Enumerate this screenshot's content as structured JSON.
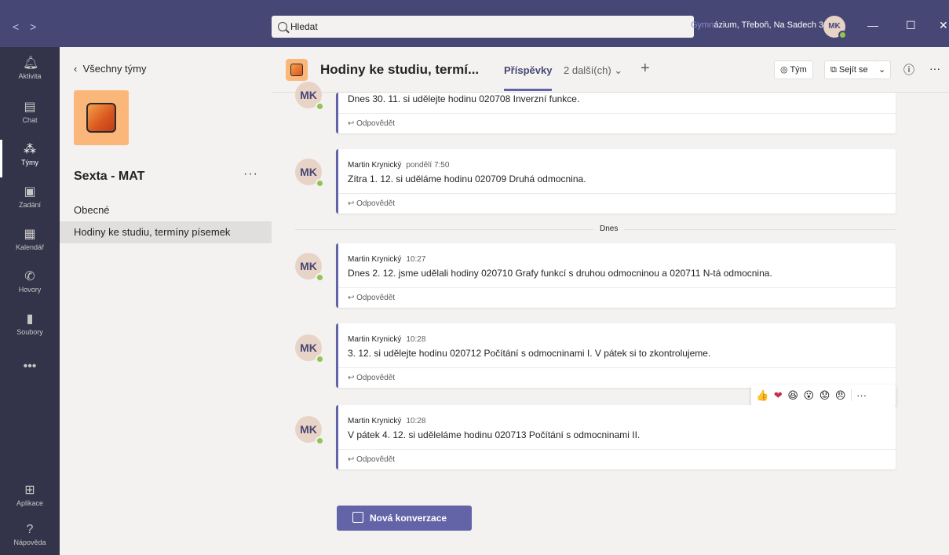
{
  "titlebar": {
    "back_icon": "chevron-left",
    "forward_icon": "chevron-right",
    "search_placeholder": "Hledat",
    "org_prefix": "Gymn",
    "org_rest": "ázium, Třeboň, Na Sadech 308",
    "avatar_initials": "MK"
  },
  "rail": {
    "items": [
      {
        "label": "Aktivita",
        "icon": "bell-icon"
      },
      {
        "label": "Chat",
        "icon": "chat-icon"
      },
      {
        "label": "Týmy",
        "icon": "teams-icon"
      },
      {
        "label": "Zadání",
        "icon": "assignments-icon"
      },
      {
        "label": "Kalendář",
        "icon": "calendar-icon"
      },
      {
        "label": "Hovory",
        "icon": "phone-icon"
      },
      {
        "label": "Soubory",
        "icon": "files-icon"
      },
      {
        "label": "Aplikace",
        "icon": "apps-icon"
      },
      {
        "label": "Nápověda",
        "icon": "help-icon"
      }
    ],
    "more_label": "•••"
  },
  "teampanel": {
    "back_label": "Všechny týmy",
    "team_name": "Sexta - MAT",
    "more_label": "···",
    "channels": [
      "Obecné",
      "Hodiny ke studiu, termíny písemek"
    ]
  },
  "header": {
    "title": "Hodiny ke studiu, termí...",
    "tab_posts": "Příspěvky",
    "tab_more": "2 další(ch) ⌄",
    "add_tab": "+",
    "team_button": "◎ Tým",
    "meet_button": "Sejít se",
    "meet_dropdown": "⌄",
    "info_icon": "ⓘ",
    "more_icon": "···"
  },
  "posts": [
    {
      "author": "",
      "time": "",
      "text": "Dnes 30. 11. si udělejte hodinu 020708 Inverzní funkce.",
      "reply": "↩ Odpovědět",
      "avatar": "MK"
    },
    {
      "author": "Martin Krynický",
      "time": "pondělí 7:50",
      "text": "Zítra 1. 12. si uděláme hodinu 020709 Druhá odmocnina.",
      "reply": "↩ Odpovědět",
      "avatar": "MK"
    },
    {
      "author": "Martin Krynický",
      "time": "10:27",
      "text": "Dnes 2. 12. jsme udělali hodiny 020710 Grafy funkcí s druhou odmocninou a 020711 N-tá odmocnina.",
      "reply": "↩ Odpovědět",
      "avatar": "MK"
    },
    {
      "author": "Martin Krynický",
      "time": "10:28",
      "text": "3. 12. si udělejte hodinu 020712 Počítání s odmocninami I. V pátek si to zkontrolujeme.",
      "reply": "↩ Odpovědět",
      "avatar": "MK"
    },
    {
      "author": "Martin Krynický",
      "time": "10:28",
      "text": "V pátek 4. 12. si uděleláme hodinu 020713 Počítání s odmocninami II.",
      "reply": "↩ Odpovědět",
      "avatar": "MK"
    }
  ],
  "divider_label": "Dnes",
  "reactions": [
    "👍",
    "❤",
    "😆",
    "😮",
    "😟",
    "😠",
    "···"
  ],
  "new_conversation": "Nová konverzace",
  "colors": {
    "titlebar": "#464775",
    "rail": "#33344a",
    "accent": "#6264a7",
    "presence": "#92c353"
  }
}
